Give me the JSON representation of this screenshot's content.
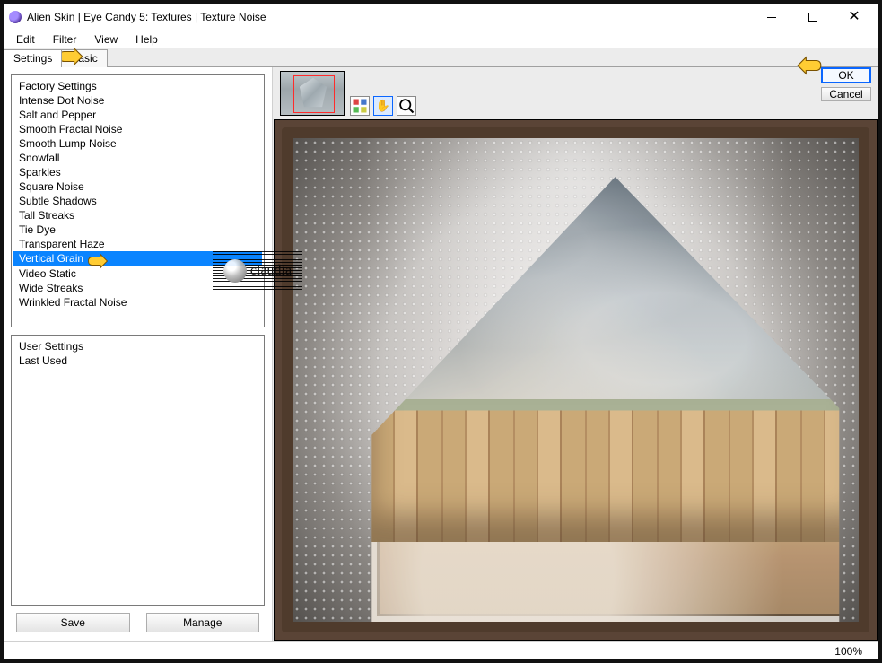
{
  "window": {
    "title": "Alien Skin | Eye Candy 5: Textures | Texture Noise"
  },
  "menubar": [
    "Edit",
    "Filter",
    "View",
    "Help"
  ],
  "tabs": {
    "settings": "Settings",
    "basic": "Basic"
  },
  "buttons": {
    "ok": "OK",
    "cancel": "Cancel",
    "save": "Save",
    "manage": "Manage"
  },
  "watermark": "claudia",
  "status": {
    "zoom": "100%"
  },
  "presets_top": [
    "Factory Settings",
    "Intense Dot Noise",
    "Salt and Pepper",
    "Smooth Fractal Noise",
    "Smooth Lump Noise",
    "Snowfall",
    "Sparkles",
    "Square Noise",
    "Subtle Shadows",
    "Tall Streaks",
    "Tie Dye",
    "Transparent Haze",
    "Vertical Grain",
    "Video Static",
    "Wide Streaks",
    "Wrinkled Fractal Noise"
  ],
  "presets_top_selected_index": 12,
  "presets_bottom": [
    "User Settings",
    "Last Used"
  ]
}
